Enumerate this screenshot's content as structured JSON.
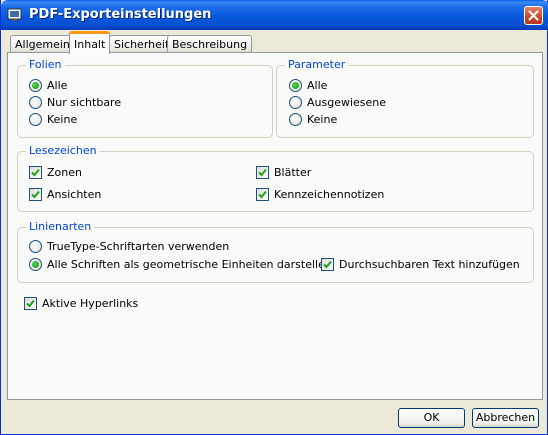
{
  "window": {
    "title": "PDF-Exporteinstellungen"
  },
  "tabs": [
    "Allgemein",
    "Inhalt",
    "Sicherheit",
    "Beschreibung"
  ],
  "folien": {
    "legend": "Folien",
    "options": [
      "Alle",
      "Nur sichtbare",
      "Keine"
    ],
    "selected": "Alle"
  },
  "parameter": {
    "legend": "Parameter",
    "options": [
      "Alle",
      "Ausgewiesene",
      "Keine"
    ],
    "selected": "Alle"
  },
  "lesezeichen": {
    "legend": "Lesezeichen",
    "zonen": "Zonen",
    "ansichten": "Ansichten",
    "blaetter": "Blätter",
    "kennzeichen": "Kennzeichennotizen"
  },
  "linienarten": {
    "legend": "Linienarten",
    "truetype": "TrueType-Schriftarten verwenden",
    "geometrisch": "Alle Schriften als geometrische Einheiten darstellen",
    "durchsuchbar": "Durchsuchbaren Text hinzufügen",
    "selected": "Alle Schriften als geometrische Einheiten darstellen"
  },
  "hyperlinks": {
    "label": "Aktive Hyperlinks"
  },
  "buttons": {
    "ok": "OK",
    "cancel": "Abbrechen"
  },
  "colors": {
    "titlebar": "#0A5FE8",
    "legend_text": "#0046D5",
    "active_tab_accent": "#FF9A18",
    "check_mark": "#21A121",
    "dialog_bg": "#ECE9D8"
  }
}
